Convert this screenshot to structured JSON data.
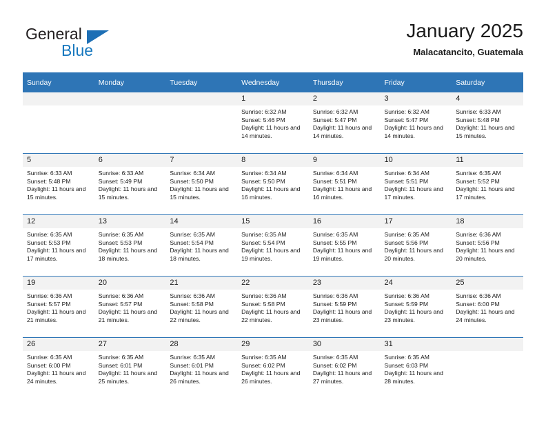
{
  "logo": {
    "word_top": "General",
    "word_bottom": "Blue",
    "triangle_color": "#1d6fb5",
    "blue_color": "#1878be"
  },
  "header": {
    "title": "January 2025",
    "location": "Malacatancito, Guatemala"
  },
  "theme": {
    "header_bg": "#2e75b6",
    "header_text": "#ffffff",
    "daynum_bg": "#f2f2f2",
    "cell_bg": "#ffffff",
    "separator": "#2e75b6"
  },
  "weekdays": [
    "Sunday",
    "Monday",
    "Tuesday",
    "Wednesday",
    "Thursday",
    "Friday",
    "Saturday"
  ],
  "labels": {
    "sunrise": "Sunrise:",
    "sunset": "Sunset:",
    "daylight": "Daylight:"
  },
  "weeks": [
    [
      {
        "day": "",
        "sunrise": "",
        "sunset": "",
        "daylight": ""
      },
      {
        "day": "",
        "sunrise": "",
        "sunset": "",
        "daylight": ""
      },
      {
        "day": "",
        "sunrise": "",
        "sunset": "",
        "daylight": ""
      },
      {
        "day": "1",
        "sunrise": "Sunrise: 6:32 AM",
        "sunset": "Sunset: 5:46 PM",
        "daylight": "Daylight: 11 hours and 14 minutes."
      },
      {
        "day": "2",
        "sunrise": "Sunrise: 6:32 AM",
        "sunset": "Sunset: 5:47 PM",
        "daylight": "Daylight: 11 hours and 14 minutes."
      },
      {
        "day": "3",
        "sunrise": "Sunrise: 6:32 AM",
        "sunset": "Sunset: 5:47 PM",
        "daylight": "Daylight: 11 hours and 14 minutes."
      },
      {
        "day": "4",
        "sunrise": "Sunrise: 6:33 AM",
        "sunset": "Sunset: 5:48 PM",
        "daylight": "Daylight: 11 hours and 15 minutes."
      }
    ],
    [
      {
        "day": "5",
        "sunrise": "Sunrise: 6:33 AM",
        "sunset": "Sunset: 5:48 PM",
        "daylight": "Daylight: 11 hours and 15 minutes."
      },
      {
        "day": "6",
        "sunrise": "Sunrise: 6:33 AM",
        "sunset": "Sunset: 5:49 PM",
        "daylight": "Daylight: 11 hours and 15 minutes."
      },
      {
        "day": "7",
        "sunrise": "Sunrise: 6:34 AM",
        "sunset": "Sunset: 5:50 PM",
        "daylight": "Daylight: 11 hours and 15 minutes."
      },
      {
        "day": "8",
        "sunrise": "Sunrise: 6:34 AM",
        "sunset": "Sunset: 5:50 PM",
        "daylight": "Daylight: 11 hours and 16 minutes."
      },
      {
        "day": "9",
        "sunrise": "Sunrise: 6:34 AM",
        "sunset": "Sunset: 5:51 PM",
        "daylight": "Daylight: 11 hours and 16 minutes."
      },
      {
        "day": "10",
        "sunrise": "Sunrise: 6:34 AM",
        "sunset": "Sunset: 5:51 PM",
        "daylight": "Daylight: 11 hours and 17 minutes."
      },
      {
        "day": "11",
        "sunrise": "Sunrise: 6:35 AM",
        "sunset": "Sunset: 5:52 PM",
        "daylight": "Daylight: 11 hours and 17 minutes."
      }
    ],
    [
      {
        "day": "12",
        "sunrise": "Sunrise: 6:35 AM",
        "sunset": "Sunset: 5:53 PM",
        "daylight": "Daylight: 11 hours and 17 minutes."
      },
      {
        "day": "13",
        "sunrise": "Sunrise: 6:35 AM",
        "sunset": "Sunset: 5:53 PM",
        "daylight": "Daylight: 11 hours and 18 minutes."
      },
      {
        "day": "14",
        "sunrise": "Sunrise: 6:35 AM",
        "sunset": "Sunset: 5:54 PM",
        "daylight": "Daylight: 11 hours and 18 minutes."
      },
      {
        "day": "15",
        "sunrise": "Sunrise: 6:35 AM",
        "sunset": "Sunset: 5:54 PM",
        "daylight": "Daylight: 11 hours and 19 minutes."
      },
      {
        "day": "16",
        "sunrise": "Sunrise: 6:35 AM",
        "sunset": "Sunset: 5:55 PM",
        "daylight": "Daylight: 11 hours and 19 minutes."
      },
      {
        "day": "17",
        "sunrise": "Sunrise: 6:35 AM",
        "sunset": "Sunset: 5:56 PM",
        "daylight": "Daylight: 11 hours and 20 minutes."
      },
      {
        "day": "18",
        "sunrise": "Sunrise: 6:36 AM",
        "sunset": "Sunset: 5:56 PM",
        "daylight": "Daylight: 11 hours and 20 minutes."
      }
    ],
    [
      {
        "day": "19",
        "sunrise": "Sunrise: 6:36 AM",
        "sunset": "Sunset: 5:57 PM",
        "daylight": "Daylight: 11 hours and 21 minutes."
      },
      {
        "day": "20",
        "sunrise": "Sunrise: 6:36 AM",
        "sunset": "Sunset: 5:57 PM",
        "daylight": "Daylight: 11 hours and 21 minutes."
      },
      {
        "day": "21",
        "sunrise": "Sunrise: 6:36 AM",
        "sunset": "Sunset: 5:58 PM",
        "daylight": "Daylight: 11 hours and 22 minutes."
      },
      {
        "day": "22",
        "sunrise": "Sunrise: 6:36 AM",
        "sunset": "Sunset: 5:58 PM",
        "daylight": "Daylight: 11 hours and 22 minutes."
      },
      {
        "day": "23",
        "sunrise": "Sunrise: 6:36 AM",
        "sunset": "Sunset: 5:59 PM",
        "daylight": "Daylight: 11 hours and 23 minutes."
      },
      {
        "day": "24",
        "sunrise": "Sunrise: 6:36 AM",
        "sunset": "Sunset: 5:59 PM",
        "daylight": "Daylight: 11 hours and 23 minutes."
      },
      {
        "day": "25",
        "sunrise": "Sunrise: 6:36 AM",
        "sunset": "Sunset: 6:00 PM",
        "daylight": "Daylight: 11 hours and 24 minutes."
      }
    ],
    [
      {
        "day": "26",
        "sunrise": "Sunrise: 6:35 AM",
        "sunset": "Sunset: 6:00 PM",
        "daylight": "Daylight: 11 hours and 24 minutes."
      },
      {
        "day": "27",
        "sunrise": "Sunrise: 6:35 AM",
        "sunset": "Sunset: 6:01 PM",
        "daylight": "Daylight: 11 hours and 25 minutes."
      },
      {
        "day": "28",
        "sunrise": "Sunrise: 6:35 AM",
        "sunset": "Sunset: 6:01 PM",
        "daylight": "Daylight: 11 hours and 26 minutes."
      },
      {
        "day": "29",
        "sunrise": "Sunrise: 6:35 AM",
        "sunset": "Sunset: 6:02 PM",
        "daylight": "Daylight: 11 hours and 26 minutes."
      },
      {
        "day": "30",
        "sunrise": "Sunrise: 6:35 AM",
        "sunset": "Sunset: 6:02 PM",
        "daylight": "Daylight: 11 hours and 27 minutes."
      },
      {
        "day": "31",
        "sunrise": "Sunrise: 6:35 AM",
        "sunset": "Sunset: 6:03 PM",
        "daylight": "Daylight: 11 hours and 28 minutes."
      },
      {
        "day": "",
        "sunrise": "",
        "sunset": "",
        "daylight": ""
      }
    ]
  ]
}
